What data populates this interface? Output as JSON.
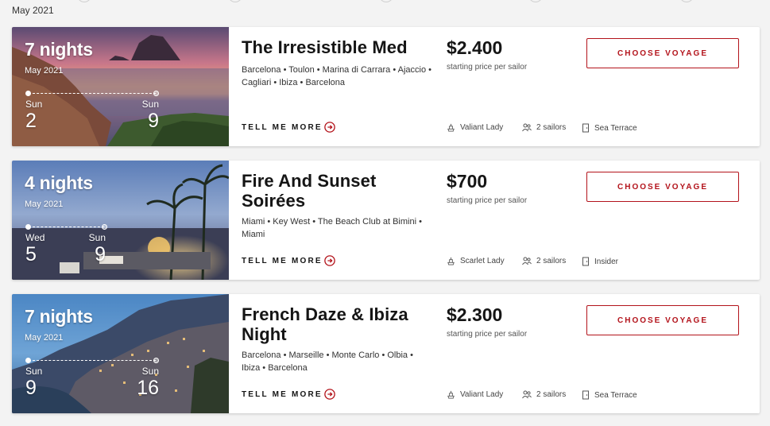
{
  "header": {
    "month": "May 2021"
  },
  "common": {
    "tell_more_label": "TELL ME MORE",
    "choose_label": "CHOOSE VOYAGE",
    "price_sub": "starting price per sailor"
  },
  "cards": [
    {
      "nights": "7 nights",
      "month": "May 2021",
      "start_dow": "Sun",
      "start_day": "2",
      "end_dow": "Sun",
      "end_day": "9",
      "title": "The Irresistible Med",
      "ports": "Barcelona • Toulon • Marina di Carrara • Ajaccio • Cagliari • Ibiza • Barcelona",
      "price": "$2.400",
      "ship": "Valiant Lady",
      "sailors": "2 sailors",
      "cabin": "Sea Terrace"
    },
    {
      "nights": "4 nights",
      "month": "May 2021",
      "start_dow": "Wed",
      "start_day": "5",
      "end_dow": "Sun",
      "end_day": "9",
      "title": "Fire And Sunset Soirées",
      "ports": "Miami • Key West • The Beach Club at Bimini • Miami",
      "price": "$700",
      "ship": "Scarlet Lady",
      "sailors": "2 sailors",
      "cabin": "Insider"
    },
    {
      "nights": "7 nights",
      "month": "May 2021",
      "start_dow": "Sun",
      "start_day": "9",
      "end_dow": "Sun",
      "end_day": "16",
      "title": "French Daze & Ibiza Night",
      "ports": "Barcelona • Marseille • Monte Carlo • Olbia • Ibiza • Barcelona",
      "price": "$2.300",
      "ship": "Valiant Lady",
      "sailors": "2 sailors",
      "cabin": "Sea Terrace"
    }
  ],
  "colors": {
    "accent": "#b3131b"
  }
}
